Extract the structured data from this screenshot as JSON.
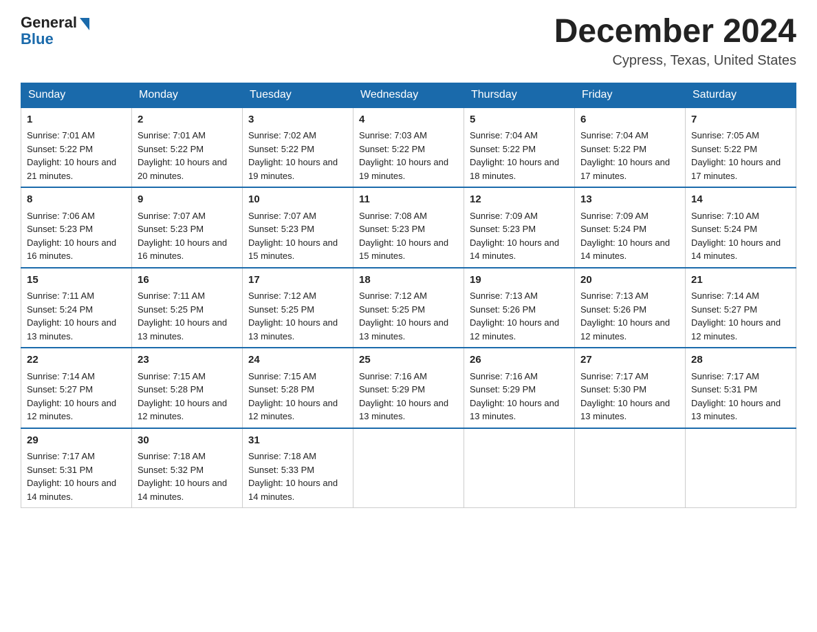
{
  "header": {
    "logo_general": "General",
    "logo_blue": "Blue",
    "month_title": "December 2024",
    "location": "Cypress, Texas, United States"
  },
  "days_of_week": [
    "Sunday",
    "Monday",
    "Tuesday",
    "Wednesday",
    "Thursday",
    "Friday",
    "Saturday"
  ],
  "weeks": [
    [
      {
        "day": "1",
        "sunrise": "7:01 AM",
        "sunset": "5:22 PM",
        "daylight": "10 hours and 21 minutes."
      },
      {
        "day": "2",
        "sunrise": "7:01 AM",
        "sunset": "5:22 PM",
        "daylight": "10 hours and 20 minutes."
      },
      {
        "day": "3",
        "sunrise": "7:02 AM",
        "sunset": "5:22 PM",
        "daylight": "10 hours and 19 minutes."
      },
      {
        "day": "4",
        "sunrise": "7:03 AM",
        "sunset": "5:22 PM",
        "daylight": "10 hours and 19 minutes."
      },
      {
        "day": "5",
        "sunrise": "7:04 AM",
        "sunset": "5:22 PM",
        "daylight": "10 hours and 18 minutes."
      },
      {
        "day": "6",
        "sunrise": "7:04 AM",
        "sunset": "5:22 PM",
        "daylight": "10 hours and 17 minutes."
      },
      {
        "day": "7",
        "sunrise": "7:05 AM",
        "sunset": "5:22 PM",
        "daylight": "10 hours and 17 minutes."
      }
    ],
    [
      {
        "day": "8",
        "sunrise": "7:06 AM",
        "sunset": "5:23 PM",
        "daylight": "10 hours and 16 minutes."
      },
      {
        "day": "9",
        "sunrise": "7:07 AM",
        "sunset": "5:23 PM",
        "daylight": "10 hours and 16 minutes."
      },
      {
        "day": "10",
        "sunrise": "7:07 AM",
        "sunset": "5:23 PM",
        "daylight": "10 hours and 15 minutes."
      },
      {
        "day": "11",
        "sunrise": "7:08 AM",
        "sunset": "5:23 PM",
        "daylight": "10 hours and 15 minutes."
      },
      {
        "day": "12",
        "sunrise": "7:09 AM",
        "sunset": "5:23 PM",
        "daylight": "10 hours and 14 minutes."
      },
      {
        "day": "13",
        "sunrise": "7:09 AM",
        "sunset": "5:24 PM",
        "daylight": "10 hours and 14 minutes."
      },
      {
        "day": "14",
        "sunrise": "7:10 AM",
        "sunset": "5:24 PM",
        "daylight": "10 hours and 14 minutes."
      }
    ],
    [
      {
        "day": "15",
        "sunrise": "7:11 AM",
        "sunset": "5:24 PM",
        "daylight": "10 hours and 13 minutes."
      },
      {
        "day": "16",
        "sunrise": "7:11 AM",
        "sunset": "5:25 PM",
        "daylight": "10 hours and 13 minutes."
      },
      {
        "day": "17",
        "sunrise": "7:12 AM",
        "sunset": "5:25 PM",
        "daylight": "10 hours and 13 minutes."
      },
      {
        "day": "18",
        "sunrise": "7:12 AM",
        "sunset": "5:25 PM",
        "daylight": "10 hours and 13 minutes."
      },
      {
        "day": "19",
        "sunrise": "7:13 AM",
        "sunset": "5:26 PM",
        "daylight": "10 hours and 12 minutes."
      },
      {
        "day": "20",
        "sunrise": "7:13 AM",
        "sunset": "5:26 PM",
        "daylight": "10 hours and 12 minutes."
      },
      {
        "day": "21",
        "sunrise": "7:14 AM",
        "sunset": "5:27 PM",
        "daylight": "10 hours and 12 minutes."
      }
    ],
    [
      {
        "day": "22",
        "sunrise": "7:14 AM",
        "sunset": "5:27 PM",
        "daylight": "10 hours and 12 minutes."
      },
      {
        "day": "23",
        "sunrise": "7:15 AM",
        "sunset": "5:28 PM",
        "daylight": "10 hours and 12 minutes."
      },
      {
        "day": "24",
        "sunrise": "7:15 AM",
        "sunset": "5:28 PM",
        "daylight": "10 hours and 12 minutes."
      },
      {
        "day": "25",
        "sunrise": "7:16 AM",
        "sunset": "5:29 PM",
        "daylight": "10 hours and 13 minutes."
      },
      {
        "day": "26",
        "sunrise": "7:16 AM",
        "sunset": "5:29 PM",
        "daylight": "10 hours and 13 minutes."
      },
      {
        "day": "27",
        "sunrise": "7:17 AM",
        "sunset": "5:30 PM",
        "daylight": "10 hours and 13 minutes."
      },
      {
        "day": "28",
        "sunrise": "7:17 AM",
        "sunset": "5:31 PM",
        "daylight": "10 hours and 13 minutes."
      }
    ],
    [
      {
        "day": "29",
        "sunrise": "7:17 AM",
        "sunset": "5:31 PM",
        "daylight": "10 hours and 14 minutes."
      },
      {
        "day": "30",
        "sunrise": "7:18 AM",
        "sunset": "5:32 PM",
        "daylight": "10 hours and 14 minutes."
      },
      {
        "day": "31",
        "sunrise": "7:18 AM",
        "sunset": "5:33 PM",
        "daylight": "10 hours and 14 minutes."
      },
      null,
      null,
      null,
      null
    ]
  ],
  "labels": {
    "sunrise": "Sunrise:",
    "sunset": "Sunset:",
    "daylight": "Daylight:"
  }
}
